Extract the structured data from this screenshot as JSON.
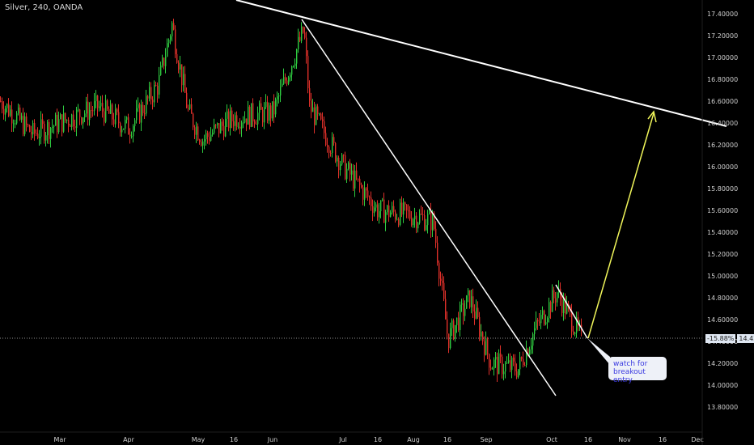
{
  "header": {
    "symbol": "Silver, 240, OANDA"
  },
  "price_tag": {
    "percent": "-15.88%",
    "value": "14.42950"
  },
  "annotation": {
    "text": "watch for breakout entry"
  },
  "colors": {
    "background": "#000000",
    "up_candle": "#2ecc40",
    "down_candle": "#e0302a",
    "trendline": "#ffffff",
    "projection_arrow": "#f0f55a",
    "price_line": "#bfbfbf"
  },
  "chart_data": {
    "type": "candlestick",
    "title": "",
    "xlabel": "",
    "ylabel": "",
    "x_ticks": [
      "Mar",
      "Apr",
      "May",
      "16",
      "Jun",
      "Jul",
      "16",
      "Aug",
      "16",
      "Sep",
      "Oct",
      "16",
      "Nov",
      "16",
      "Dec"
    ],
    "y_ticks": [
      "17.40000",
      "17.20000",
      "17.00000",
      "16.80000",
      "16.60000",
      "16.40000",
      "16.20000",
      "16.00000",
      "15.80000",
      "15.60000",
      "15.40000",
      "15.20000",
      "15.00000",
      "14.80000",
      "14.60000",
      "14.40000",
      "14.20000",
      "14.00000",
      "13.80000"
    ],
    "ylim": [
      13.8,
      17.4
    ],
    "close_path": [
      {
        "t": "Mar",
        "p": 16.6
      },
      {
        "t": "Mar 10",
        "p": 16.3
      },
      {
        "t": "Mar 20",
        "p": 16.55
      },
      {
        "t": "Apr",
        "p": 16.35
      },
      {
        "t": "Apr 15",
        "p": 16.75
      },
      {
        "t": "Apr 22",
        "p": 17.3
      },
      {
        "t": "May",
        "p": 16.5
      },
      {
        "t": "May 10",
        "p": 16.25
      },
      {
        "t": "16",
        "p": 16.45
      },
      {
        "t": "Jun",
        "p": 16.5
      },
      {
        "t": "Jun 10",
        "p": 17.25
      },
      {
        "t": "Jun 15",
        "p": 16.55
      },
      {
        "t": "Jul",
        "p": 16.0
      },
      {
        "t": "16",
        "p": 15.6
      },
      {
        "t": "Aug",
        "p": 15.55
      },
      {
        "t": "Aug 10",
        "p": 15.5
      },
      {
        "t": "16",
        "p": 14.42
      },
      {
        "t": "Aug 25",
        "p": 14.8
      },
      {
        "t": "Sep",
        "p": 14.2
      },
      {
        "t": "Sep 15",
        "p": 14.15
      },
      {
        "t": "Sep 25",
        "p": 14.5
      },
      {
        "t": "Oct",
        "p": 14.85
      },
      {
        "t": "Oct 10",
        "p": 14.43
      }
    ]
  }
}
